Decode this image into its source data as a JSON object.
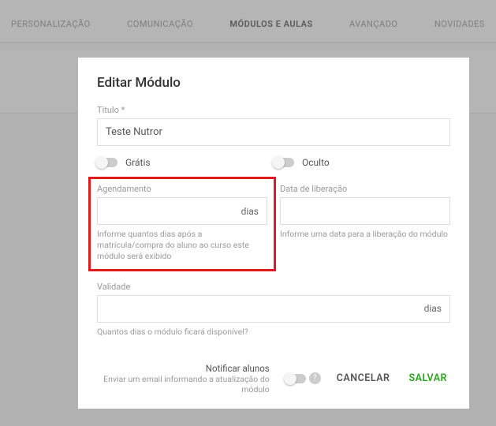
{
  "nav": {
    "items": [
      "PERSONALIZAÇÃO",
      "COMUNICAÇÃO",
      "MÓDULOS E AULAS",
      "AVANÇADO",
      "NOVIDADES"
    ]
  },
  "modal": {
    "title": "Editar Módulo",
    "titulo_label": "Titulo *",
    "titulo_value": "Teste Nutror",
    "gratis_label": "Grátis",
    "oculto_label": "Oculto",
    "agendamento": {
      "label": "Agendamento",
      "suffix": "dias",
      "help": "Informe quantos dias após a matrícula/compra do aluno ao curso este módulo será exibido"
    },
    "liberacao": {
      "label": "Data de liberação",
      "help": "Informe uma data para a liberação do módulo"
    },
    "validade": {
      "label": "Validade",
      "suffix": "dias",
      "help": "Quantos dias o módulo ficará disponível?"
    },
    "notify": {
      "title": "Notificar alunos",
      "sub": "Enviar um email informando a atualização do módulo",
      "help_icon": "?"
    },
    "cancel": "CANCELAR",
    "save": "SALVAR"
  }
}
